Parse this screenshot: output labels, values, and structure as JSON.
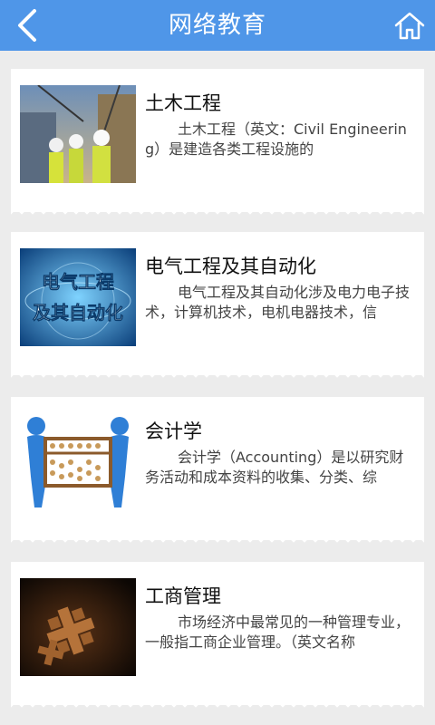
{
  "header": {
    "title": "网络教育",
    "back_icon": "back-chevron-icon",
    "home_icon": "home-icon",
    "bar_color": "#4f96e8"
  },
  "courses": [
    {
      "title": "土木工程",
      "desc": "土木工程（英文：Civil Engineering）是建造各类工程设施的",
      "image": "construction-workers-photo"
    },
    {
      "title": "电气工程及其自动化",
      "desc": "电气工程及其自动化涉及电力电子技术，计算机技术，电机电器技术，信",
      "image": "electrical-engineering-banner",
      "image_text_line1": "电气工程",
      "image_text_line2": "及其自动化"
    },
    {
      "title": "会计学",
      "desc": "会计学（Accounting）是以研究财务活动和成本资料的收集、分类、综",
      "image": "abacus-figures-illustration"
    },
    {
      "title": "工商管理",
      "desc": "市场经济中最常见的一种管理专业，一般指工商企业管理。（英文名称",
      "image": "gears-dark-photo"
    }
  ]
}
